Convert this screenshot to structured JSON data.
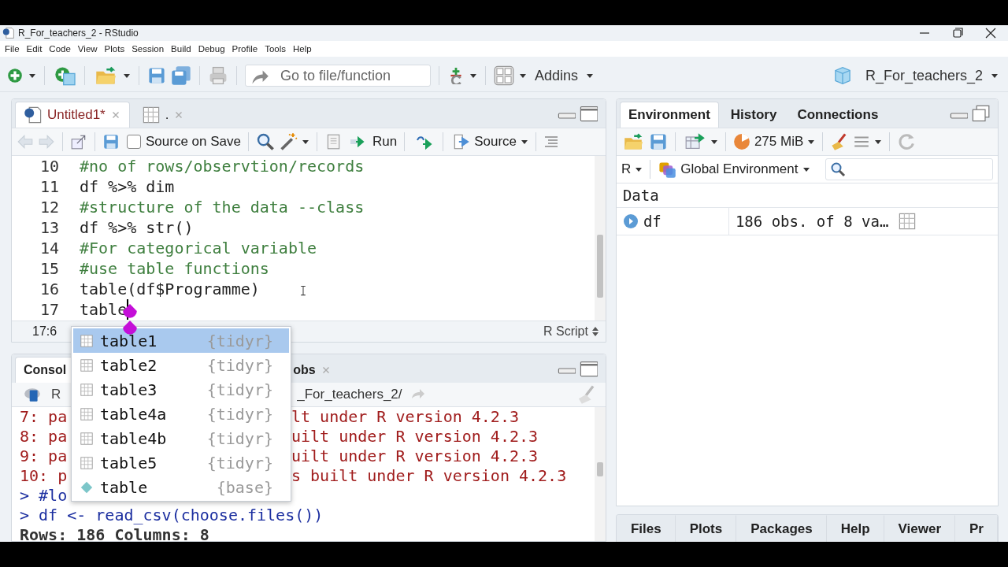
{
  "window": {
    "title": "R_For_teachers_2 - RStudio"
  },
  "menu": [
    "File",
    "Edit",
    "Code",
    "View",
    "Plots",
    "Session",
    "Build",
    "Debug",
    "Profile",
    "Tools",
    "Help"
  ],
  "toolbar": {
    "goto_placeholder": "Go to file/function",
    "addins": "Addins",
    "project": "R_For_teachers_2"
  },
  "editor": {
    "tabs": [
      {
        "label": "Untitled1*",
        "kind": "script",
        "selected": true
      },
      {
        "label": ".",
        "kind": "data",
        "selected": false
      }
    ],
    "source_on_save": {
      "label": "Source on Save",
      "checked": false
    },
    "run": "Run",
    "source": "Source",
    "lines": [
      {
        "number": "10",
        "kind": "comment",
        "text": "#no of rows/observtion/records",
        "cursor": false
      },
      {
        "number": "11",
        "kind": "code",
        "text": "df %>% dim",
        "cursor": false
      },
      {
        "number": "12",
        "kind": "comment",
        "text": "#structure of the data --class",
        "cursor": false
      },
      {
        "number": "13",
        "kind": "code",
        "text": "df %>% str()",
        "cursor": false
      },
      {
        "number": "14",
        "kind": "comment",
        "text": "#For categorical variable",
        "cursor": false
      },
      {
        "number": "15",
        "kind": "comment",
        "text": "#use table functions",
        "cursor": false
      },
      {
        "number": "16",
        "kind": "code",
        "text": "table(df$Programme)",
        "cursor": false
      },
      {
        "number": "17",
        "kind": "code",
        "text": "table",
        "cursor": true
      }
    ],
    "position": "17:6",
    "file_type": "R Script"
  },
  "autocomplete": [
    {
      "name": "table1",
      "package": "{tidyr}",
      "kind": "dataset",
      "selected": true
    },
    {
      "name": "table2",
      "package": "{tidyr}",
      "kind": "dataset",
      "selected": false
    },
    {
      "name": "table3",
      "package": "{tidyr}",
      "kind": "dataset",
      "selected": false
    },
    {
      "name": "table4a",
      "package": "{tidyr}",
      "kind": "dataset",
      "selected": false
    },
    {
      "name": "table4b",
      "package": "{tidyr}",
      "kind": "dataset",
      "selected": false
    },
    {
      "name": "table5",
      "package": "{tidyr}",
      "kind": "dataset",
      "selected": false
    },
    {
      "name": "table",
      "package": "{base}",
      "kind": "function",
      "selected": false
    }
  ],
  "console": {
    "tabs": [
      {
        "label": "Consol",
        "selected": true
      },
      {
        "label": "obs",
        "selected": false
      }
    ],
    "version_label": "R",
    "path": "_For_teachers_2/",
    "lines": [
      {
        "kind": "warning",
        "left": "7: pa",
        "right": "lt under R version 4.2.3"
      },
      {
        "kind": "warning",
        "left": "8: pa",
        "right": "uilt under R version 4.2.3"
      },
      {
        "kind": "warning",
        "left": "9: pa",
        "right": "uilt under R version 4.2.3"
      },
      {
        "kind": "warning",
        "left": "10: p",
        "right": "s built under R version 4.2.3"
      },
      {
        "kind": "input",
        "left": "> #lo"
      },
      {
        "kind": "input",
        "left": "> df <- read_csv(choose.files())"
      },
      {
        "kind": "output",
        "left": "Rows: 186 Columns: 8"
      }
    ]
  },
  "environment": {
    "tabs": [
      {
        "label": "Environment",
        "selected": true
      },
      {
        "label": "History",
        "selected": false
      },
      {
        "label": "Connections",
        "selected": false
      }
    ],
    "memory": "275 MiB",
    "language": "R",
    "scope": "Global Environment",
    "section": "Data",
    "rows": [
      {
        "name": "df",
        "value": "186 obs. of 8 va…"
      }
    ]
  },
  "files_pane": {
    "tabs": [
      {
        "label": "Files",
        "selected": false
      },
      {
        "label": "Plots",
        "selected": false
      },
      {
        "label": "Packages",
        "selected": false
      },
      {
        "label": "Help",
        "selected": false
      },
      {
        "label": "Viewer",
        "selected": false
      },
      {
        "label": "Pr",
        "selected": false
      }
    ]
  }
}
